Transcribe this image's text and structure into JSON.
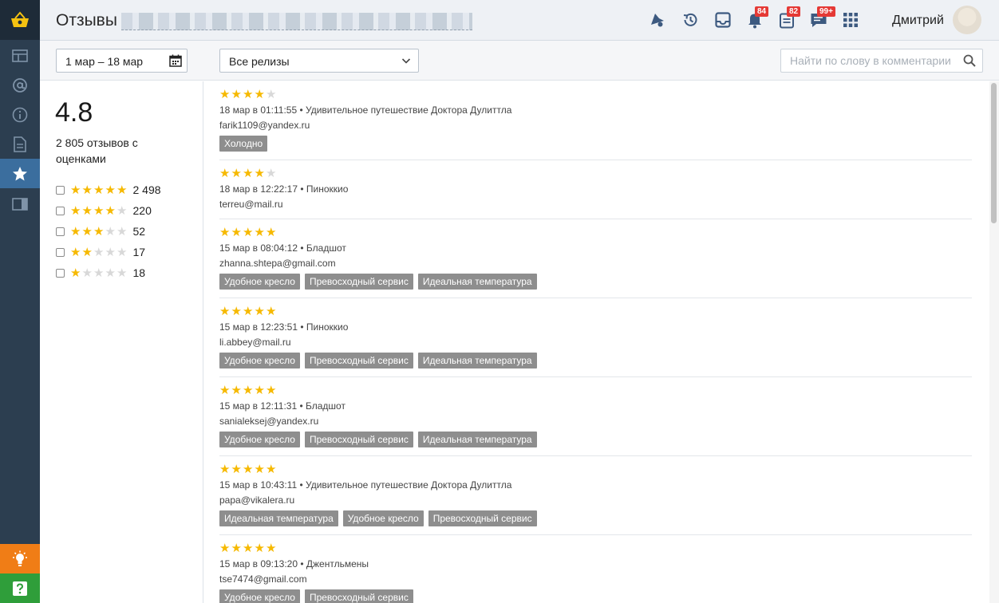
{
  "header": {
    "title": "Отзывы",
    "user_name": "Дмитрий",
    "badges": {
      "notifications": "84",
      "tasks": "82",
      "messages": "99+"
    }
  },
  "filters": {
    "date_range": "1 мар – 18 мар",
    "release": "Все релизы",
    "search_placeholder": "Найти по слову в комментарии"
  },
  "summary": {
    "average": "4.8",
    "total": "2 805 отзывов с оценками",
    "distribution": [
      {
        "stars": 5,
        "count": "2 498"
      },
      {
        "stars": 4,
        "count": "220"
      },
      {
        "stars": 3,
        "count": "52"
      },
      {
        "stars": 2,
        "count": "17"
      },
      {
        "stars": 1,
        "count": "18"
      }
    ]
  },
  "reviews": [
    {
      "rating": 4,
      "meta": "18 мар в 01:11:55 • Удивительное путешествие Доктора Дулиттла",
      "author": "farik1109@yandex.ru",
      "tags": [
        "Холодно"
      ]
    },
    {
      "rating": 4,
      "meta": "18 мар в 12:22:17 • Пиноккио",
      "author": "terreu@mail.ru",
      "tags": []
    },
    {
      "rating": 5,
      "meta": "15 мар в 08:04:12 • Бладшот",
      "author": "zhanna.shtepa@gmail.com",
      "tags": [
        "Удобное кресло",
        "Превосходный сервис",
        "Идеальная температура"
      ]
    },
    {
      "rating": 5,
      "meta": "15 мар в 12:23:51 • Пиноккио",
      "author": "li.abbey@mail.ru",
      "tags": [
        "Удобное кресло",
        "Превосходный сервис",
        "Идеальная температура"
      ]
    },
    {
      "rating": 5,
      "meta": "15 мар в 12:11:31 • Бладшот",
      "author": "sanialeksej@yandex.ru",
      "tags": [
        "Удобное кресло",
        "Превосходный сервис",
        "Идеальная температура"
      ]
    },
    {
      "rating": 5,
      "meta": "15 мар в 10:43:11 • Удивительное путешествие Доктора Дулиттла",
      "author": "papa@vikalera.ru",
      "tags": [
        "Идеальная температура",
        "Удобное кресло",
        "Превосходный сервис"
      ]
    },
    {
      "rating": 5,
      "meta": "15 мар в 09:13:20 • Джентльмены",
      "author": "tse7474@gmail.com",
      "tags": [
        "Удобное кресло",
        "Превосходный сервис"
      ]
    }
  ],
  "colors": {
    "star_on": "#f6b900",
    "star_off": "#d8d8d8",
    "sidebar": "#2c3e50",
    "sidebar_active": "#3b6e9e",
    "tag": "#8e8e8e",
    "badge": "#e53935"
  },
  "icons": {
    "sidebar": [
      "basket-icon",
      "layout-icon",
      "at-icon",
      "info-icon",
      "document-icon",
      "star-icon",
      "panel-icon",
      "lightbulb-icon",
      "help-icon"
    ],
    "header": [
      "rocket-icon",
      "history-icon",
      "inbox-icon",
      "bell-icon",
      "tasks-icon",
      "chat-icon",
      "apps-grid-icon"
    ]
  }
}
